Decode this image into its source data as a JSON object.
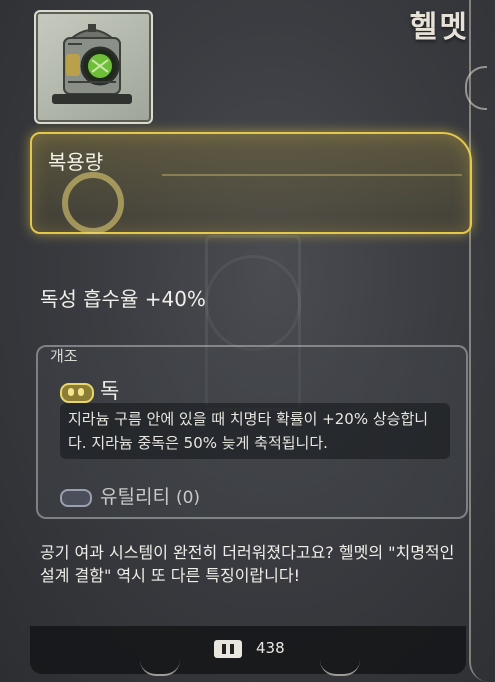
{
  "item": {
    "title": "헬멧",
    "icon": "helmet-icon"
  },
  "header": {
    "label": "복용량"
  },
  "stat": {
    "text": "독성 흡수율 +40%"
  },
  "mods": {
    "section_title": "개조",
    "toxic": {
      "icon": "toxic-mod-icon",
      "name": "독",
      "description": "지라늄 구름 안에 있을 때 치명타 확률이 +20% 상승합니다. 지라늄 중독은 50% 늦게 축적됩니다."
    },
    "utility": {
      "icon": "utility-mod-icon",
      "name": "유틸리티",
      "count": "(0)"
    }
  },
  "flavor_text": "공기 여과 시스템이 완전히 더러워졌다고요? 헬멧의 \"치명적인 설계 결함\" 역시 또 다른 특징이랍니다!",
  "footer": {
    "cost_icon": "scrap-currency-icon",
    "cost": "438"
  },
  "colors": {
    "accent": "#e3c84a",
    "panel_bg": "#3a3c41",
    "text": "#f0efe9"
  }
}
